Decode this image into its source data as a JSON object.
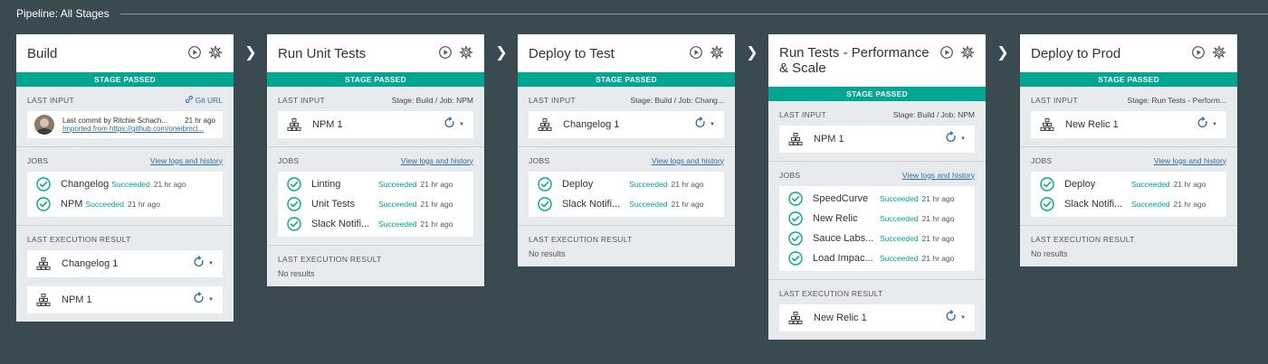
{
  "pipeline": {
    "title": "Pipeline: All Stages"
  },
  "labels": {
    "stage_passed": "STAGE PASSED",
    "last_input": "LAST INPUT",
    "jobs": "JOBS",
    "last_execution_result": "LAST EXECUTION RESULT",
    "view_logs": "View logs and history",
    "no_results": "No results",
    "git_url": "Git URL"
  },
  "colors": {
    "background": "#3a4a51",
    "passed": "#00a691",
    "link": "#2c6da8"
  },
  "icons": {
    "play": "play-icon",
    "settings": "gear-icon",
    "arrow": "chevron-right-icon",
    "job": "check-circle-icon",
    "input": "build-stack-icon",
    "redeploy": "redeploy-icon"
  },
  "stages": [
    {
      "name": "Build",
      "input_context": "",
      "commit": {
        "text": "Last commit by Ritchie Schach...",
        "time": "21 hr ago",
        "link": "Imported from https://github.com/oneibmcl..."
      },
      "inputs": [],
      "jobs": [
        {
          "name": "Changelog",
          "status": "Succeeded",
          "time": "21 hr ago"
        },
        {
          "name": "NPM",
          "status": "Succeeded",
          "time": "21 hr ago"
        }
      ],
      "results": [
        "Changelog 1",
        "NPM 1"
      ]
    },
    {
      "name": "Run Unit Tests",
      "input_context": "Stage: Build  /  Job: NPM",
      "inputs": [
        "NPM 1"
      ],
      "jobs": [
        {
          "name": "Linting",
          "status": "Succeeded",
          "time": "21 hr ago"
        },
        {
          "name": "Unit Tests",
          "status": "Succeeded",
          "time": "21 hr ago"
        },
        {
          "name": "Slack Notifi...",
          "status": "Succeeded",
          "time": "21 hr ago"
        }
      ],
      "results": []
    },
    {
      "name": "Deploy to Test",
      "input_context": "Stage: Build  /  Job: Chang...",
      "inputs": [
        "Changelog 1"
      ],
      "jobs": [
        {
          "name": "Deploy",
          "status": "Succeeded",
          "time": "21 hr ago"
        },
        {
          "name": "Slack Notifi...",
          "status": "Succeeded",
          "time": "21 hr ago"
        }
      ],
      "results": []
    },
    {
      "name": "Run Tests - Performance & Scale",
      "input_context": "Stage: Build  /  Job: NPM",
      "inputs": [
        "NPM 1"
      ],
      "jobs": [
        {
          "name": "SpeedCurve",
          "status": "Succeeded",
          "time": "21 hr ago"
        },
        {
          "name": "New Relic",
          "status": "Succeeded",
          "time": "21 hr ago"
        },
        {
          "name": "Sauce Labs...",
          "status": "Succeeded",
          "time": "21 hr ago"
        },
        {
          "name": "Load Impac...",
          "status": "Succeeded",
          "time": "21 hr ago"
        }
      ],
      "results": [
        "New Relic 1"
      ]
    },
    {
      "name": "Deploy to Prod",
      "input_context": "Stage: Run Tests - Perform...",
      "inputs": [
        "New Relic 1"
      ],
      "jobs": [
        {
          "name": "Deploy",
          "status": "Succeeded",
          "time": "21 hr ago"
        },
        {
          "name": "Slack Notifi...",
          "status": "Succeeded",
          "time": "21 hr ago"
        }
      ],
      "results": []
    }
  ]
}
